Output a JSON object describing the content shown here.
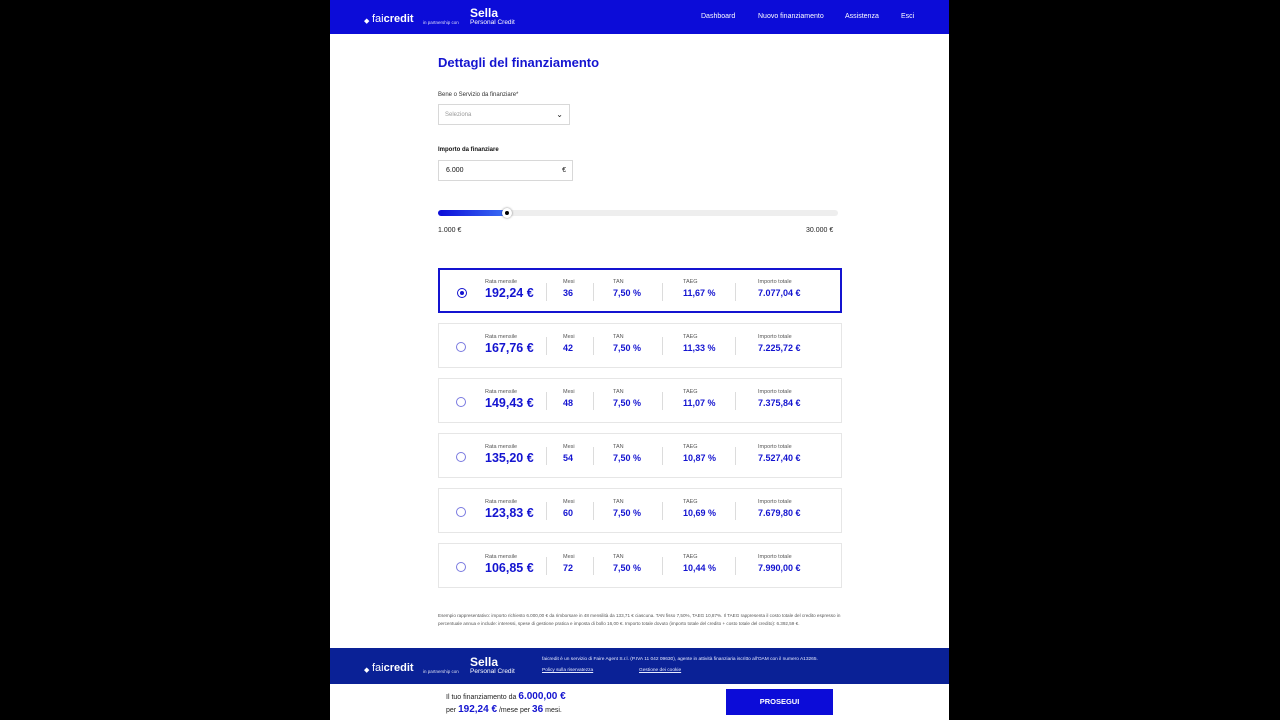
{
  "header": {
    "logo": {
      "brand_light": "fai",
      "brand_bold": "credit",
      "partner_text": "in partnership con",
      "sella": "Sella",
      "personal_credit": "Personal Credit"
    },
    "nav": [
      "Dashboard",
      "Nuovo finanziamento",
      "Assistenza",
      "Esci"
    ]
  },
  "page_title": "Dettagli del finanziamento",
  "form": {
    "bene_label": "Bene o Servizio da finanziare*",
    "bene_placeholder": "Seleziona",
    "importo_label": "Importo da finanziare",
    "importo_value": "6.000",
    "currency": "€"
  },
  "slider": {
    "min_label": "1.000 €",
    "max_label": "30.000 €",
    "value_fraction": 0.1724
  },
  "column_labels": {
    "rata": "Rata mensile",
    "mesi": "Mesi",
    "tan": "TAN",
    "taeg": "TAEG",
    "totale": "Importo totale"
  },
  "plans": [
    {
      "rata": "192,24 €",
      "mesi": "36",
      "tan": "7,50 %",
      "taeg": "11,67 %",
      "totale": "7.077,04 €",
      "selected": true
    },
    {
      "rata": "167,76 €",
      "mesi": "42",
      "tan": "7,50 %",
      "taeg": "11,33 %",
      "totale": "7.225,72 €",
      "selected": false
    },
    {
      "rata": "149,43 €",
      "mesi": "48",
      "tan": "7,50 %",
      "taeg": "11,07 %",
      "totale": "7.375,84 €",
      "selected": false
    },
    {
      "rata": "135,20 €",
      "mesi": "54",
      "tan": "7,50 %",
      "taeg": "10,87 %",
      "totale": "7.527,40 €",
      "selected": false
    },
    {
      "rata": "123,83 €",
      "mesi": "60",
      "tan": "7,50 %",
      "taeg": "10,69 %",
      "totale": "7.679,80 €",
      "selected": false
    },
    {
      "rata": "106,85 €",
      "mesi": "72",
      "tan": "7,50 %",
      "taeg": "10,44 %",
      "totale": "7.990,00 €",
      "selected": false
    }
  ],
  "note": "Esempio rappresentativo: importo richiesto 6.000,00 € da rimborsare in 48 mensilità da 133,71 € ciascuna. TAN fisso 7,50%, TAEG 10,87%. Il TAEG rappresenta il costo totale del credito espresso in percentuale annua e include: interessi, spese di gestione pratica e imposta di bollo 16,00 €. Importo totale dovuto (importo totale del credito + costo totale del credito): 6.392,59 €.",
  "footer": {
    "text": "faicredit è un servizio di Faire Agent S.r.l. (P.IVA 11 042 09630), agente in attività finanziaria iscritto all'OAM con il numero A13265.",
    "links": [
      "Policy sulla riservatezza",
      "Gestione dei cookie"
    ]
  },
  "summary": {
    "line1": "Il tuo finanziamento da",
    "amount": "6.000,00 €",
    "per": "per",
    "rata": "192,24 €",
    "mese_per": "/mese per",
    "mesi": "36",
    "mesi_suffix": "mesi."
  },
  "cta": "PROSEGUI",
  "colors": {
    "accent": "#0c0cd8",
    "footer": "#0a2196"
  }
}
